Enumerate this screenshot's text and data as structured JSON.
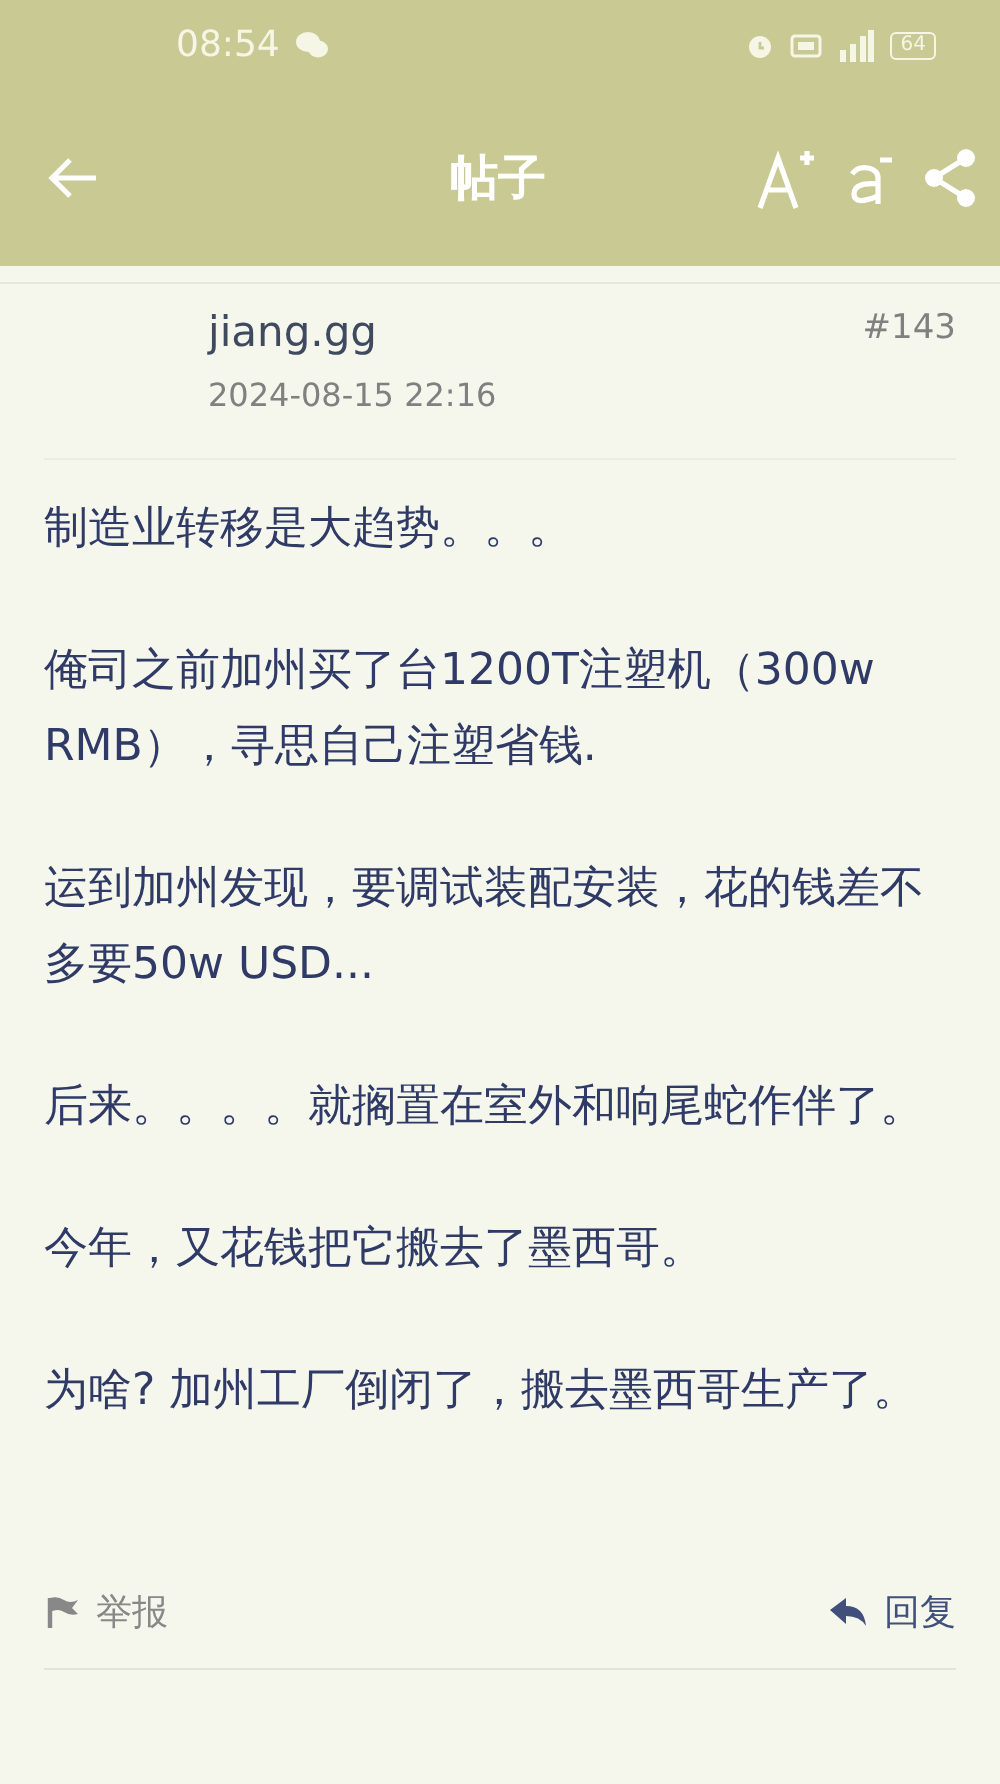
{
  "status_bar": {
    "time": "08:54",
    "battery": "64"
  },
  "app_bar": {
    "title": "帖子"
  },
  "post": {
    "author": "jiang.gg",
    "date": "2024-08-15 22:16",
    "floor": "#143",
    "paragraphs": [
      "制造业转移是大趋势。。。",
      "俺司之前加州买了台1200T注塑机（300w RMB），寻思自己注塑省钱.",
      "运到加州发现，要调试装配安装，花的钱差不多要50w USD...",
      "后来。。。。就搁置在室外和响尾蛇作伴了。",
      "今年，又花钱把它搬去了墨西哥。",
      "为啥? 加州工厂倒闭了，搬去墨西哥生产了。"
    ],
    "actions": {
      "report": "举报",
      "reply": "回复"
    }
  }
}
